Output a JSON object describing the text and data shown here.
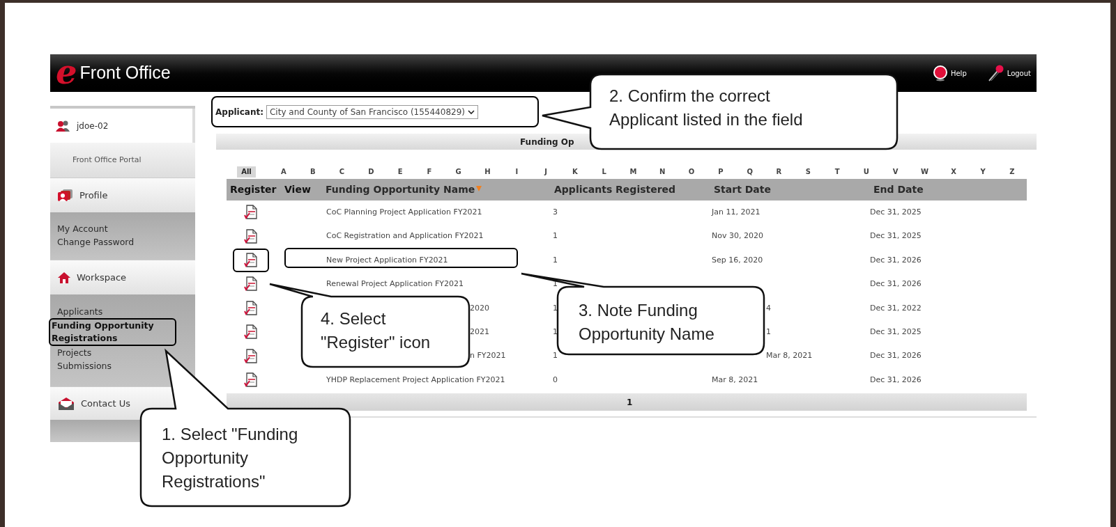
{
  "header": {
    "logo_letter": "e",
    "title": "Front Office",
    "links": [
      {
        "label": "Help",
        "kind": "help"
      },
      {
        "label": "Logout",
        "kind": "logout"
      }
    ]
  },
  "sidebar": {
    "user": "jdoe-02",
    "portal": "Front Office Portal",
    "sections": [
      {
        "label": "Profile",
        "kind": "profile",
        "items": [
          {
            "label": "My Account",
            "selected": false
          },
          {
            "label": "Change Password",
            "selected": false
          }
        ]
      },
      {
        "label": "Workspace",
        "kind": "workspace",
        "items": [
          {
            "label": "Applicants",
            "selected": false
          },
          {
            "label": "Funding Opportunity Registrations",
            "selected": true
          },
          {
            "label": "Projects",
            "selected": false
          },
          {
            "label": "Submissions",
            "selected": false
          }
        ]
      },
      {
        "label": "Contact Us",
        "kind": "contact"
      }
    ]
  },
  "applicant": {
    "label": "Applicant:",
    "value": "City and County of San Francisco (155440829)"
  },
  "panel": {
    "title": "Funding Op",
    "letters": [
      {
        "label": "All",
        "selected": true
      },
      {
        "label": "A",
        "selected": false
      },
      {
        "label": "B",
        "selected": false
      },
      {
        "label": "C",
        "selected": false
      },
      {
        "label": "D",
        "selected": false
      },
      {
        "label": "E",
        "selected": false
      },
      {
        "label": "F",
        "selected": false
      },
      {
        "label": "G",
        "selected": false
      },
      {
        "label": "H",
        "selected": false
      },
      {
        "label": "I",
        "selected": false
      },
      {
        "label": "J",
        "selected": false
      },
      {
        "label": "K",
        "selected": false
      },
      {
        "label": "L",
        "selected": false
      },
      {
        "label": "M",
        "selected": false
      },
      {
        "label": "N",
        "selected": false
      },
      {
        "label": "O",
        "selected": false
      },
      {
        "label": "P",
        "selected": false
      },
      {
        "label": "Q",
        "selected": false
      },
      {
        "label": "R",
        "selected": false
      },
      {
        "label": "S",
        "selected": false
      },
      {
        "label": "T",
        "selected": false
      },
      {
        "label": "U",
        "selected": false
      },
      {
        "label": "V",
        "selected": false
      },
      {
        "label": "W",
        "selected": false
      },
      {
        "label": "X",
        "selected": false
      },
      {
        "label": "Y",
        "selected": false
      },
      {
        "label": "Z",
        "selected": false
      }
    ],
    "columns": [
      "Register",
      "View",
      "Funding Opportunity Name",
      "Applicants Registered",
      "Start Date",
      "End Date"
    ],
    "rows": [
      {
        "name": "CoC Planning Project Application FY2021",
        "applicants": "3",
        "start": "Jan 11, 2021",
        "end": "Dec 31, 2025",
        "partial": false,
        "highlighted": false
      },
      {
        "name": "CoC Registration and Application FY2021",
        "applicants": "1",
        "start": "Nov 30, 2020",
        "end": "Dec 31, 2025",
        "partial": false,
        "highlighted": false
      },
      {
        "name": "New Project Application FY2021",
        "applicants": "1",
        "start": "Sep 16, 2020",
        "end": "Dec 31, 2026",
        "partial": false,
        "highlighted": true
      },
      {
        "name": "Renewal Project Application FY2021",
        "applicants": "1",
        "end": "Dec 31, 2026",
        "partial": false,
        "highlighted": false
      },
      {
        "name": "2020",
        "applicants": "1",
        "start": "4",
        "end": "Dec 31, 2022",
        "partial": true,
        "highlighted": false
      },
      {
        "name": "2021",
        "applicants": "1",
        "start": "1",
        "end": "Dec 31, 2025",
        "partial": true,
        "highlighted": false
      },
      {
        "name": "n FY2021",
        "applicants": "1",
        "start": "Mar 8, 2021",
        "end": "Dec 31, 2026",
        "partial": true,
        "highlighted": false
      },
      {
        "name": "YHDP Replacement Project Application FY2021",
        "applicants": "0",
        "start": "Mar 8, 2021",
        "end": "Dec 31, 2026",
        "partial": false,
        "highlighted": false
      }
    ],
    "pager": "1"
  },
  "callouts": [
    {
      "text": "1. Select \"Funding Opportunity Registrations\""
    },
    {
      "text": "2. Confirm the correct Applicant listed in the field"
    },
    {
      "text": "3. Note Funding Opportunity Name"
    },
    {
      "text": "4. Select \"Register\" icon"
    }
  ]
}
